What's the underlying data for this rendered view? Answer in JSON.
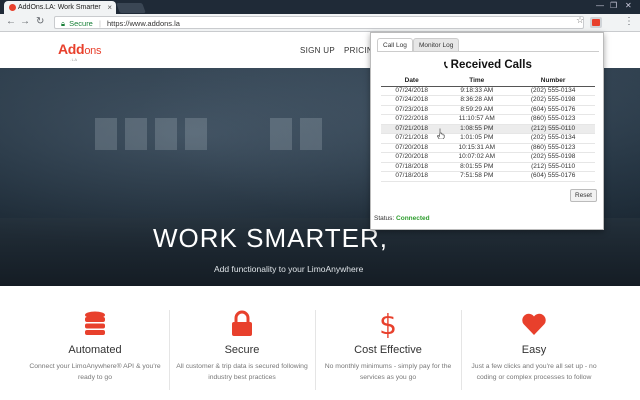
{
  "browser": {
    "tab_title": "AddOns.LA: Work Smarter",
    "tab_close": "×",
    "window_min": "—",
    "window_max": "❐",
    "window_close": "✕",
    "back": "←",
    "forward": "→",
    "reload": "↻",
    "secure_label": "Secure",
    "separator": "|",
    "url": "https://www.addons.la",
    "bookmark": "☆",
    "menu": "⋮"
  },
  "site": {
    "logo_main": "Add",
    "logo_ons": "ons",
    "logo_tld": ".LA",
    "nav": {
      "signup": "SIGN UP",
      "pricing": "PRICIN"
    },
    "hero_title": "WORK SMARTER,",
    "hero_subtitle": "Add functionality to your LimoAnywhere"
  },
  "features": [
    {
      "title": "Automated",
      "desc": "Connect your LimoAnywhere® API & you're ready to go",
      "icon": "database-icon"
    },
    {
      "title": "Secure",
      "desc": "All customer & trip data is secured following industry best practices",
      "icon": "lock-icon"
    },
    {
      "title": "Cost Effective",
      "desc": "No monthly minimums - simply pay for the services as you go",
      "icon": "dollar-icon"
    },
    {
      "title": "Easy",
      "desc": "Just a few clicks and you're all set up - no coding or complex processes to follow",
      "icon": "heart-icon"
    }
  ],
  "accent_color": "#e8402c",
  "popup": {
    "tab_call_log": "Call Log",
    "tab_monitor_log": "Monitor Log",
    "title": "Received Calls",
    "columns": {
      "date": "Date",
      "time": "Time",
      "number": "Number"
    },
    "rows": [
      {
        "date": "07/24/2018",
        "time": "9:18:33 AM",
        "number": "(202) 555-0134"
      },
      {
        "date": "07/24/2018",
        "time": "8:36:28 AM",
        "number": "(202) 555-0198"
      },
      {
        "date": "07/23/2018",
        "time": "8:59:29 AM",
        "number": "(604) 555-0176"
      },
      {
        "date": "07/22/2018",
        "time": "11:10:57 AM",
        "number": "(860) 555-0123"
      },
      {
        "date": "07/21/2018",
        "time": "1:08:55 PM",
        "number": "(212) 555-0110"
      },
      {
        "date": "07/21/2018",
        "time": "1:01:05 PM",
        "number": "(202) 555-0134"
      },
      {
        "date": "07/20/2018",
        "time": "10:15:31 AM",
        "number": "(860) 555-0123"
      },
      {
        "date": "07/20/2018",
        "time": "10:07:02 AM",
        "number": "(202) 555-0198"
      },
      {
        "date": "07/18/2018",
        "time": "8:01:55 PM",
        "number": "(212) 555-0110"
      },
      {
        "date": "07/18/2018",
        "time": "7:51:58 PM",
        "number": "(604) 555-0176"
      }
    ],
    "reset_label": "Reset",
    "status_label": "Status:",
    "status_value": "Connected",
    "status_color": "#2e9d2e"
  }
}
